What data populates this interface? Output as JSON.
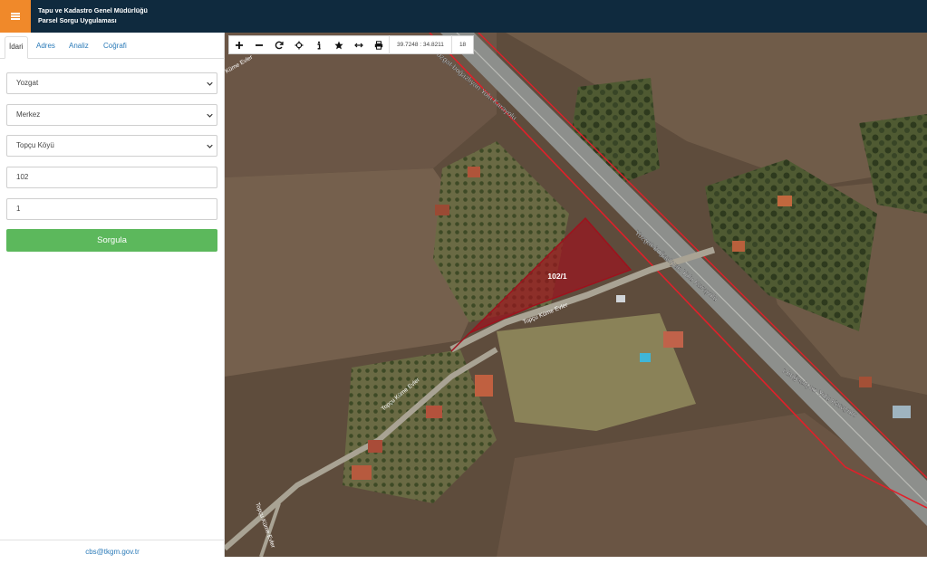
{
  "header": {
    "title_line1": "Tapu ve Kadastro Genel Müdürlüğü",
    "title_line2": "Parsel Sorgu Uygulaması",
    "menu_icon": "hamburger-icon",
    "colors": {
      "bar": "#0f2a3e",
      "menu": "#f0892a"
    }
  },
  "sidebar": {
    "tabs": [
      {
        "label": "İdari",
        "active": true
      },
      {
        "label": "Adres",
        "active": false
      },
      {
        "label": "Analiz",
        "active": false
      },
      {
        "label": "Coğrafi",
        "active": false
      }
    ],
    "il_select": "Yozgat",
    "ilce_select": "Merkez",
    "mahalle_select": "Topçu Köyü",
    "ada_input": "102",
    "parsel_input": "1",
    "query_button": "Sorgula",
    "footer_email": "cbs@tkgm.gov.tr",
    "colors": {
      "button": "#5cb85c",
      "link": "#2a7ab8"
    }
  },
  "map": {
    "tools": [
      "zoom-in-icon",
      "zoom-out-icon",
      "refresh-icon",
      "locate-icon",
      "info-icon",
      "star-icon",
      "measure-icon",
      "print-icon"
    ],
    "coordinates": "39.7248 : 34.8211",
    "zoom": "18",
    "parcel_label": "102/1",
    "road_labels": {
      "road_top": "Yozgat-boğazlıyan Yolu Karayolu",
      "road_mid": "Yozgat-boğazlıyan Yolu Karayolu",
      "road_bottom": "t-boğazlıyan Yolu Karayolu",
      "street_upper": "Topçu Küme Evler",
      "street_lower": "Topçu Küme Evler",
      "street_vertical": "Topçu Küme Evler",
      "street_corner": "Küme Evler"
    },
    "colors": {
      "parcel": "#a0101c",
      "boundary": "#e0202a"
    }
  }
}
